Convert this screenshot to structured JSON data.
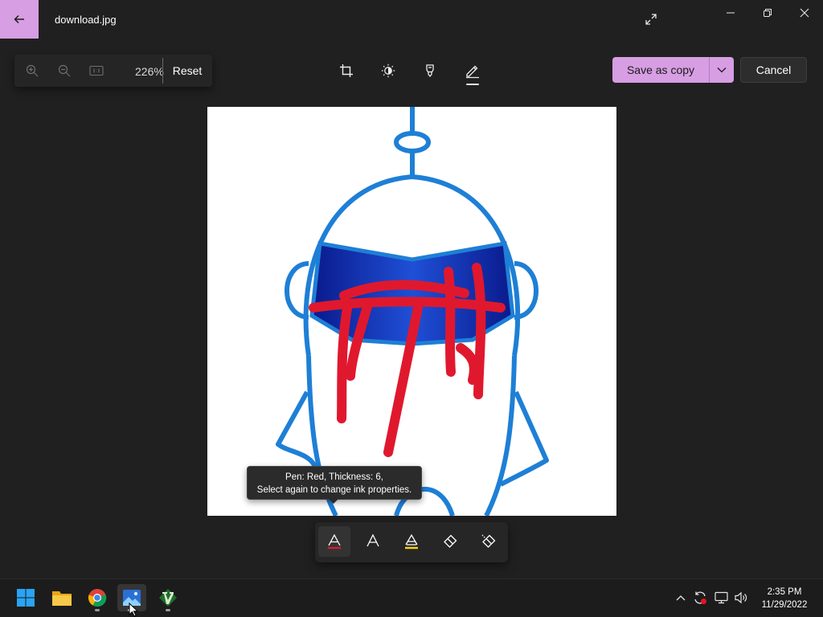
{
  "window": {
    "title": "download.jpg",
    "back_icon": "arrow-left-icon",
    "accent": "#d79ee3"
  },
  "view": {
    "zoom_level": "226%",
    "reset_label": "Reset"
  },
  "edit_tools": [
    "crop-icon",
    "brightness-icon",
    "markup-icon",
    "draw-icon"
  ],
  "actions": {
    "save_label": "Save as copy",
    "cancel_label": "Cancel"
  },
  "tooltip": {
    "line1": "Pen: Red, Thickness: 6,",
    "line2": "Select again to change ink properties."
  },
  "ink_tools": [
    "pen-red",
    "pen-white",
    "highlighter-yellow",
    "eraser",
    "clear-all"
  ],
  "ink_colors": {
    "pen": "#e0182e",
    "highlighter": "#ffd400"
  },
  "taskbar": {
    "apps": [
      "start",
      "file-explorer",
      "chrome",
      "photos",
      "vim"
    ],
    "time": "2:35 PM",
    "date": "11/29/2022"
  }
}
